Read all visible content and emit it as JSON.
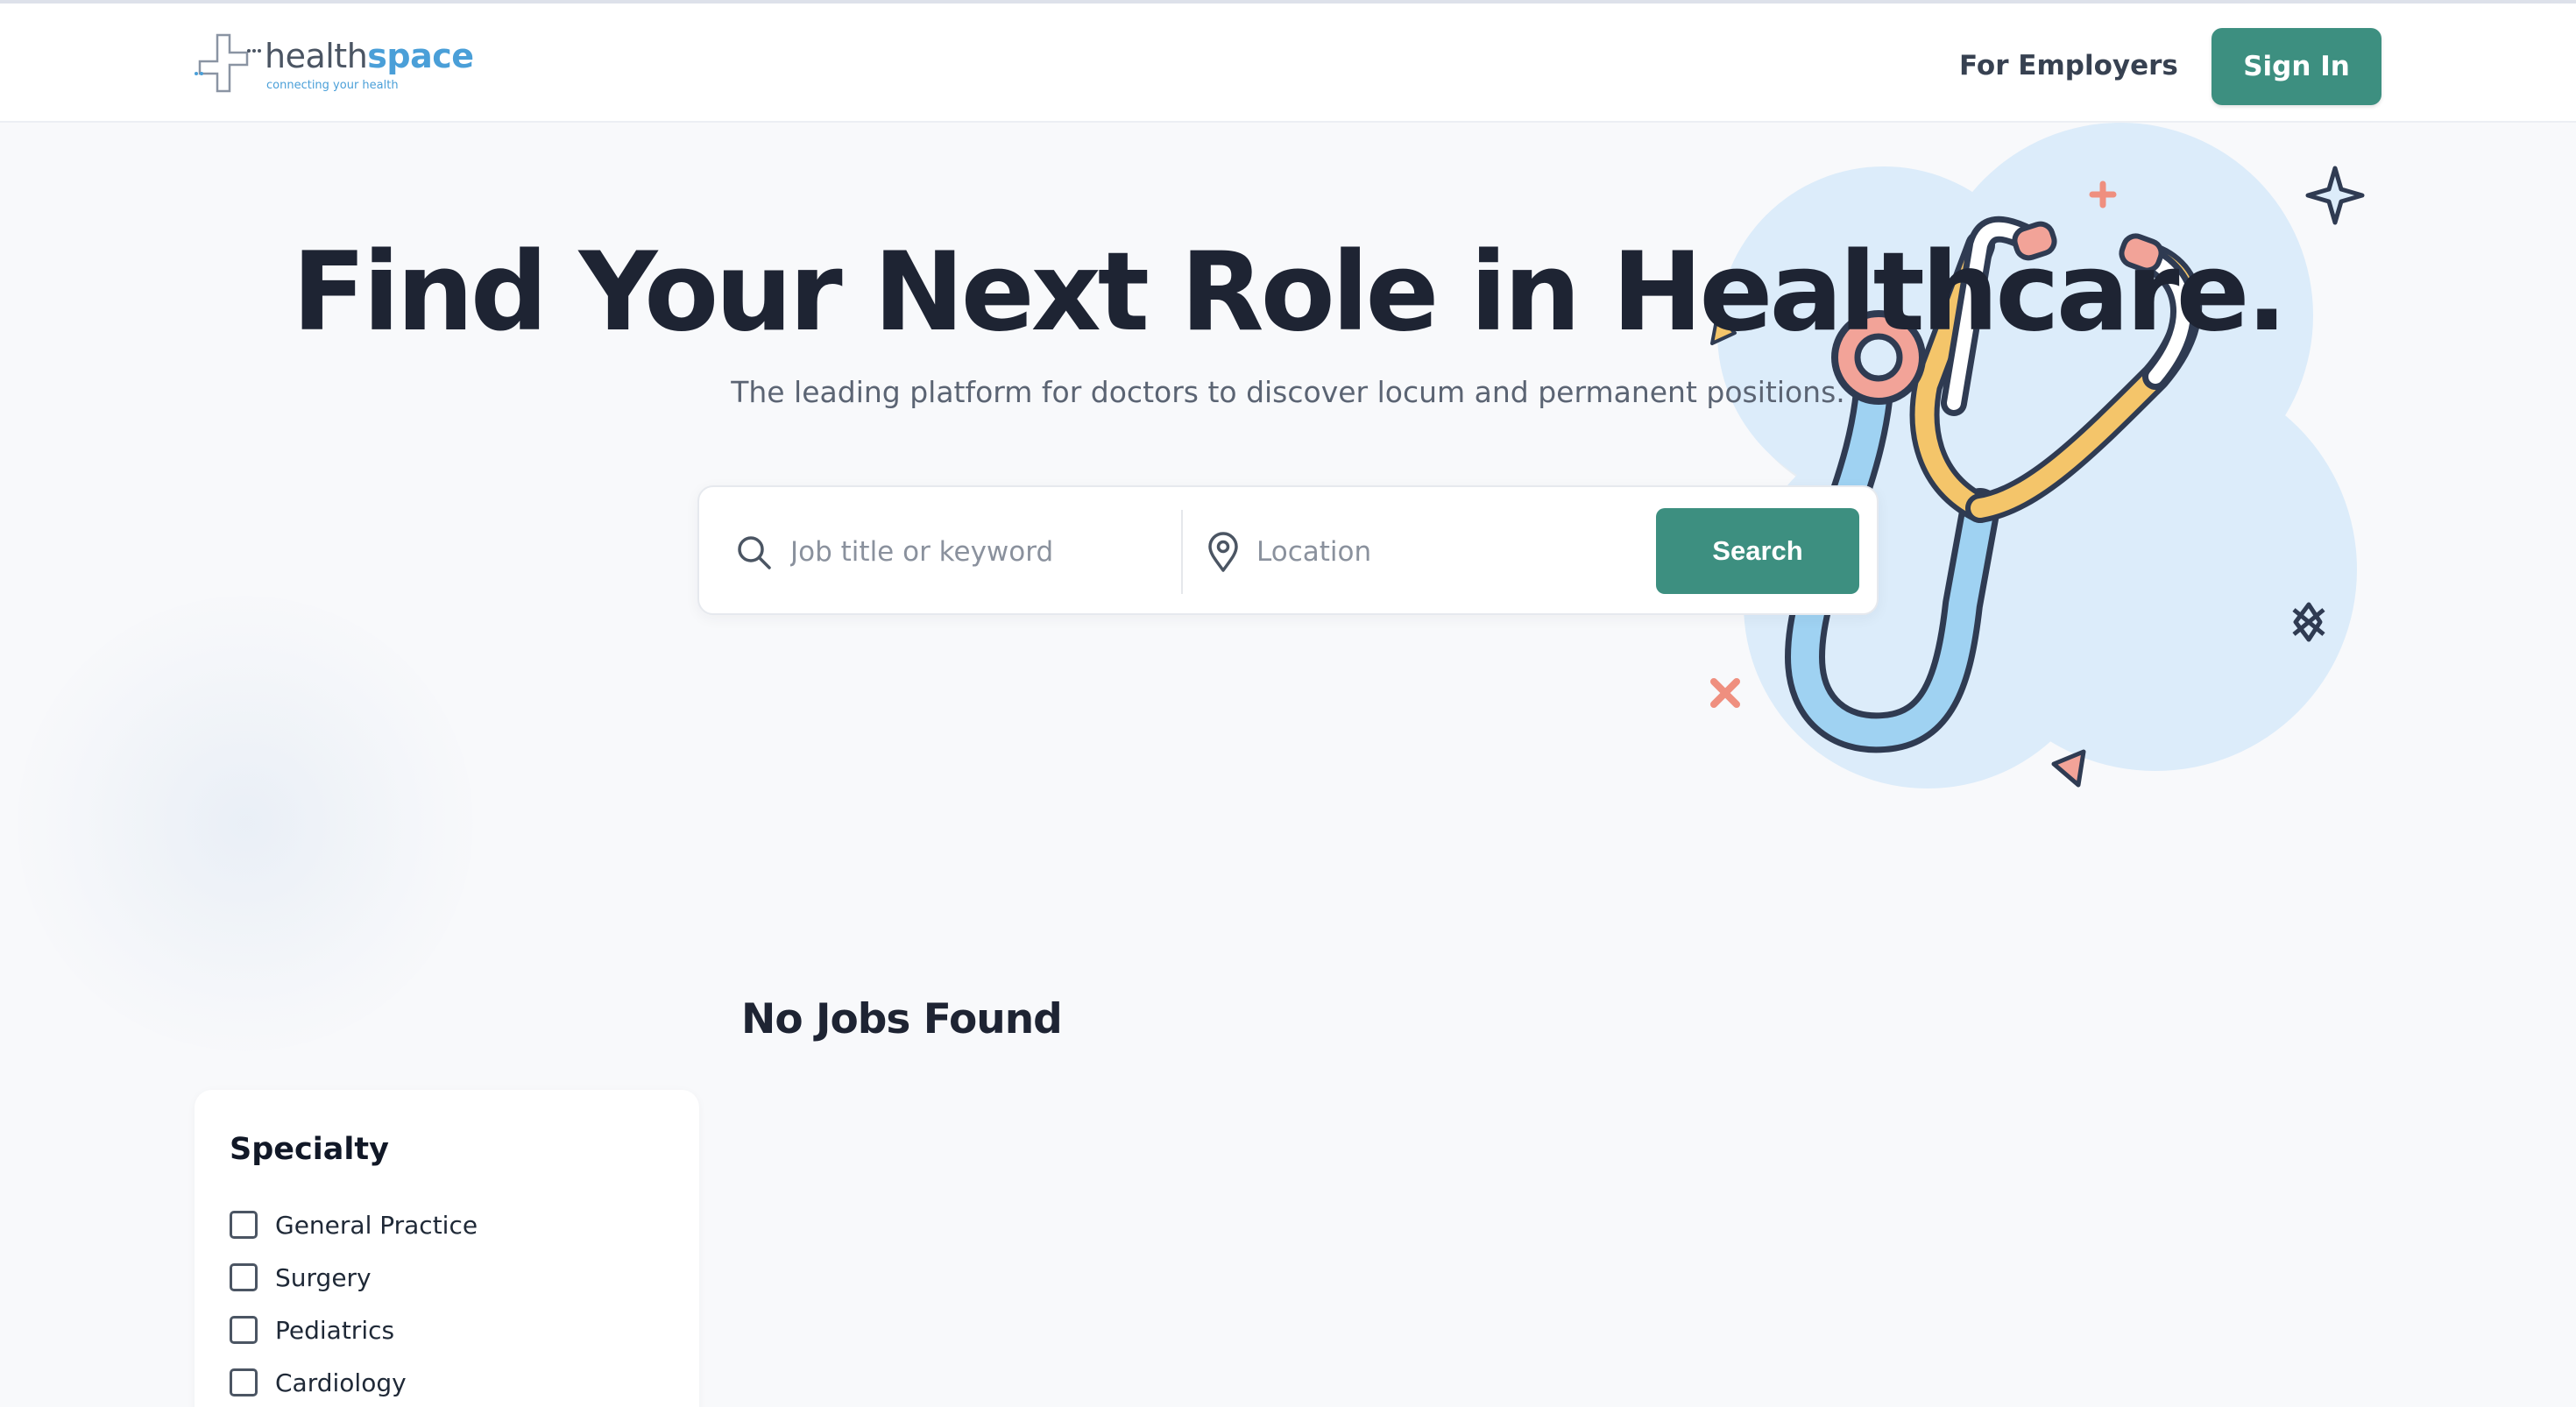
{
  "header": {
    "logo": {
      "name_part1": "health",
      "name_part2": "space",
      "tagline": "connecting your health"
    },
    "nav": {
      "for_employers": "For Employers",
      "sign_in": "Sign In"
    }
  },
  "hero": {
    "title": "Find Your Next Role in Healthcare.",
    "subtitle": "The leading platform for doctors to discover locum and permanent positions."
  },
  "search": {
    "keyword_placeholder": "Job title or keyword",
    "keyword_value": "",
    "location_placeholder": "Location",
    "location_value": "",
    "button_label": "Search"
  },
  "results": {
    "heading": "No Jobs Found"
  },
  "filters": {
    "specialty": {
      "title": "Specialty",
      "options": [
        {
          "label": "General Practice",
          "checked": false
        },
        {
          "label": "Surgery",
          "checked": false
        },
        {
          "label": "Pediatrics",
          "checked": false
        },
        {
          "label": "Cardiology",
          "checked": false
        }
      ]
    }
  },
  "colors": {
    "primary": "#3d8f80",
    "title_text": "#1e2433",
    "logo_blue": "#4a9fd8",
    "illustration_bg": "#dcecfa"
  },
  "icons": [
    "search-icon",
    "location-pin-icon",
    "stethoscope-illustration"
  ]
}
